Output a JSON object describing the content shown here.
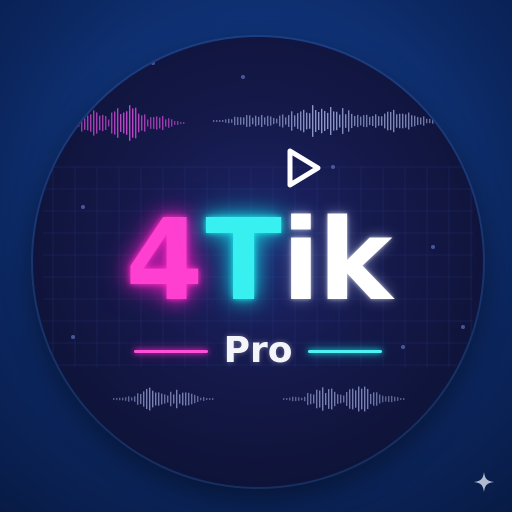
{
  "logo": {
    "char_four": "4",
    "char_t": "T",
    "char_ik": "ik",
    "subtitle": "Pro",
    "icon": "play-icon"
  },
  "corner": {
    "icon": "sparkle-icon"
  },
  "colors": {
    "magenta": "#ff3fd0",
    "cyan": "#38f0f0",
    "white": "#ffffff",
    "background": "#0d2a63",
    "disc": "#141847"
  }
}
